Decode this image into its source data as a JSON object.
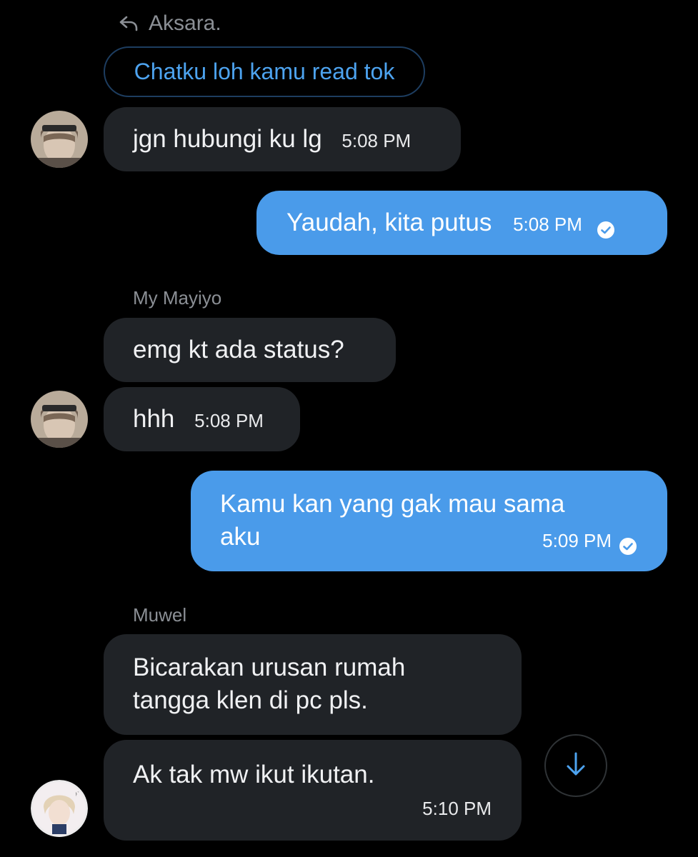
{
  "reply": {
    "icon": "reply-arrow-icon",
    "name": "Aksara.",
    "quoted_text": "Chatku loh kamu read tok"
  },
  "messages": [
    {
      "dir": "in",
      "text": "jgn hubungi ku lg",
      "time": "5:08 PM"
    },
    {
      "dir": "out",
      "text": "Yaudah, kita putus",
      "time": "5:08 PM",
      "status": "check-icon"
    },
    {
      "sender": "My Mayiyo",
      "dir": "in",
      "text": "emg kt ada status?"
    },
    {
      "dir": "in",
      "text": "hhh",
      "time": "5:08 PM"
    },
    {
      "dir": "out",
      "text": "Kamu kan yang gak mau sama aku",
      "time": "5:09 PM",
      "status": "check-icon"
    },
    {
      "sender": "Muwel",
      "dir": "in",
      "text": "Bicarakan urusan rumah tangga klen di pc pls."
    },
    {
      "dir": "in",
      "text": "Ak tak mw ikut ikutan.",
      "time": "5:10 PM"
    }
  ],
  "scroll_button": {
    "icon": "arrow-down-icon"
  },
  "colors": {
    "background": "#000000",
    "incoming_bubble": "#202327",
    "outgoing_bubble": "#4a9bea",
    "accent": "#4da3ef",
    "muted_text": "#8b8f95"
  }
}
